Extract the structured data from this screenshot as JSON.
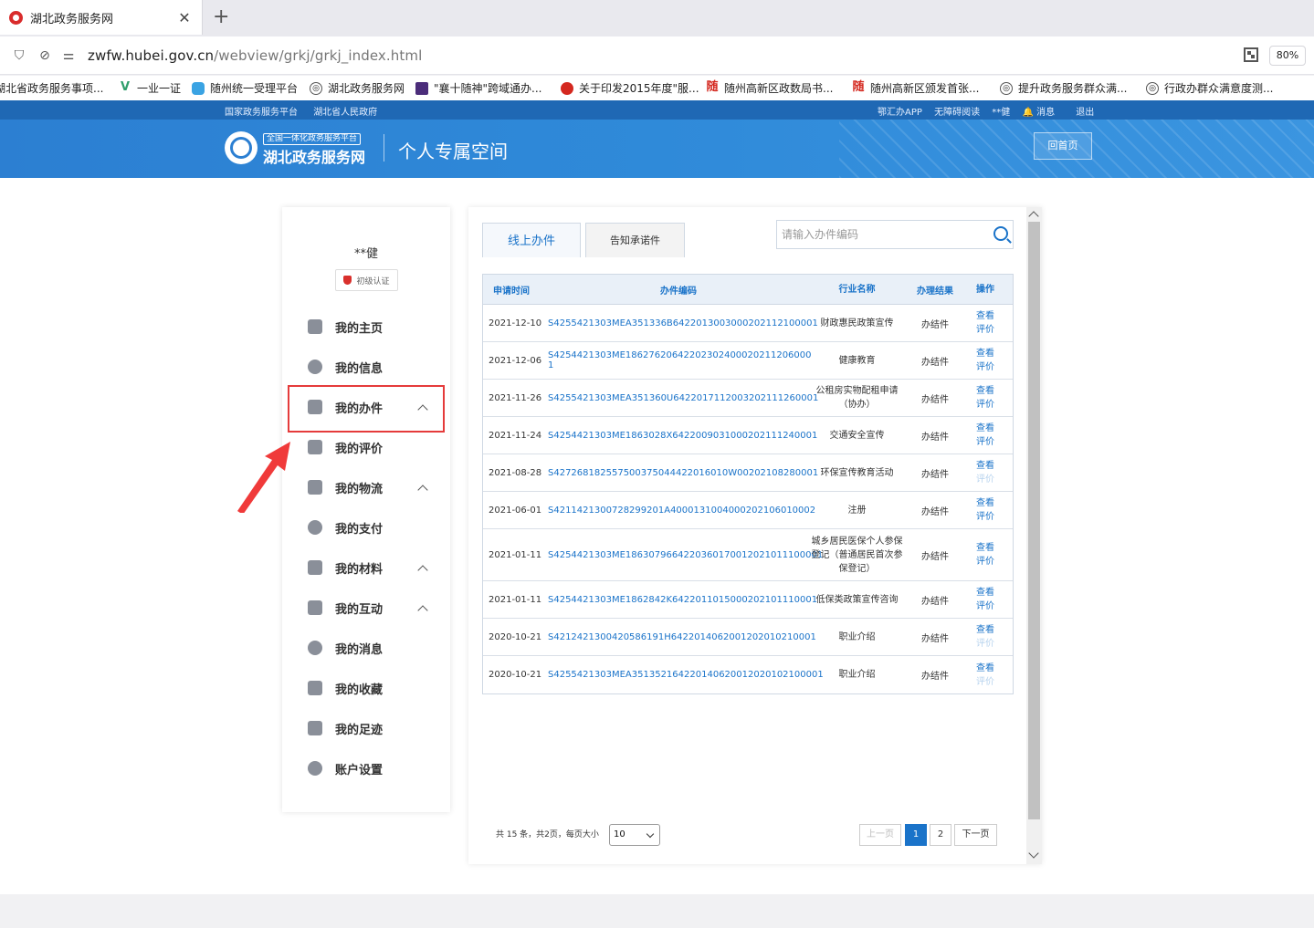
{
  "browser": {
    "tab_title": "湖北政务服务网",
    "url_host": "zwfw.hubei.gov.cn",
    "url_path": "/webview/grkj/grkj_index.html",
    "zoom": "80%",
    "bookmarks": [
      {
        "label": "湖北省政务服务事项...",
        "icon": "globe-icon"
      },
      {
        "label": "一业一证",
        "icon": "v-icon"
      },
      {
        "label": "随州统一受理平台",
        "icon": "cloud-icon"
      },
      {
        "label": "湖北政务服务网",
        "icon": "globe-icon"
      },
      {
        "label": "\"襄十随神\"跨域通办...",
        "icon": "inspur-icon"
      },
      {
        "label": "关于印发2015年度\"服...",
        "icon": "gov-emblem-icon"
      },
      {
        "label": "随州高新区政数局书...",
        "icon": "sui-icon"
      },
      {
        "label": "随州高新区颁发首张...",
        "icon": "sui-icon"
      },
      {
        "label": "提升政务服务群众满...",
        "icon": "globe-icon"
      },
      {
        "label": "行政办群众满意度测...",
        "icon": "globe-icon"
      }
    ]
  },
  "site": {
    "top_links_left": [
      "国家政务服务平台",
      "湖北省人民政府"
    ],
    "top_links_right": [
      "鄂汇办APP",
      "无障碍阅读",
      "**健",
      "消息",
      "退出"
    ],
    "logo_small": "全国一体化政务服务平台",
    "logo_big": "湖北政务服务网",
    "title": "个人专属空间",
    "home_button": "回首页"
  },
  "sidebar": {
    "username": "**健",
    "cert": "初级认证",
    "items": [
      {
        "label": "我的主页",
        "icon": "home-icon",
        "caret": false
      },
      {
        "label": "我的信息",
        "icon": "message-icon",
        "caret": false
      },
      {
        "label": "我的办件",
        "icon": "edit-icon",
        "caret": true
      },
      {
        "label": "我的评价",
        "icon": "document-icon",
        "caret": false
      },
      {
        "label": "我的物流",
        "icon": "box-icon",
        "caret": true
      },
      {
        "label": "我的支付",
        "icon": "yuan-icon",
        "caret": false
      },
      {
        "label": "我的材料",
        "icon": "book-icon",
        "caret": true
      },
      {
        "label": "我的互动",
        "icon": "chat-icon",
        "caret": true
      },
      {
        "label": "我的消息",
        "icon": "bell-icon",
        "caret": false
      },
      {
        "label": "我的收藏",
        "icon": "star-icon",
        "caret": false
      },
      {
        "label": "我的足迹",
        "icon": "footprint-icon",
        "caret": false
      },
      {
        "label": "账户设置",
        "icon": "gear-icon",
        "caret": false
      }
    ]
  },
  "main": {
    "tabs": [
      "线上办件",
      "告知承诺件"
    ],
    "search_placeholder": "请输入办件编码",
    "headers": [
      "申请时间",
      "办件编码",
      "行业名称",
      "办理结果",
      "操作"
    ],
    "rows": [
      {
        "date": "2021-12-10",
        "code": "S4255421303MEA351336B6422013003000202112100001",
        "industry": "财政惠民政策宣传",
        "result": "办结件",
        "view": "查看",
        "rate": "评价",
        "rate_dim": false
      },
      {
        "date": "2021-12-06",
        "code": "S4254421303ME18627620642202302400020211206000​1",
        "industry": "健康教育",
        "result": "办结件",
        "view": "查看",
        "rate": "评价",
        "rate_dim": false
      },
      {
        "date": "2021-11-26",
        "code": "S4255421303MEA351360U6422017112003202111260001",
        "industry": "公租房实物配租申请（协办）",
        "result": "办结件",
        "view": "查看",
        "rate": "评价",
        "rate_dim": false
      },
      {
        "date": "2021-11-24",
        "code": "S4254421303ME1863028X6422009031000202111240001",
        "industry": "交通安全宣传",
        "result": "办结件",
        "view": "查看",
        "rate": "评价",
        "rate_dim": false
      },
      {
        "date": "2021-08-28",
        "code": "S427268182557500375044422016010W00202108280001",
        "industry": "环保宣传教育活动",
        "result": "办结件",
        "view": "查看",
        "rate": "评价",
        "rate_dim": true
      },
      {
        "date": "2021-06-01",
        "code": "S4211421300728299201A4000131004000202106010002",
        "industry": "注册",
        "result": "办结件",
        "view": "查看",
        "rate": "评价",
        "rate_dim": false
      },
      {
        "date": "2021-01-11",
        "code": "S4254421303ME1863079664220360170012021011100001",
        "industry": "城乡居民医保个人参保登记（普通居民首次参保登记）",
        "result": "办结件",
        "view": "查看",
        "rate": "评价",
        "rate_dim": false
      },
      {
        "date": "2021-01-11",
        "code": "S4254421303ME1862842K6422011015000202101110001",
        "industry": "低保类政策宣传咨询",
        "result": "办结件",
        "view": "查看",
        "rate": "评价",
        "rate_dim": false
      },
      {
        "date": "2020-10-21",
        "code": "S4212421300420586191H6422014062001202010210001",
        "industry": "职业介绍",
        "result": "办结件",
        "view": "查看",
        "rate": "评价",
        "rate_dim": true
      },
      {
        "date": "2020-10-21",
        "code": "S4255421303MEA351352164220140620012020102100001",
        "industry": "职业介绍",
        "result": "办结件",
        "view": "查看",
        "rate": "评价",
        "rate_dim": true
      }
    ],
    "pager": {
      "info": "共 15 条，共2页，每页大小",
      "page_size": "10",
      "prev": "上一页",
      "pages": [
        "1",
        "2"
      ],
      "next": "下一页"
    }
  },
  "colors": {
    "accent": "#1a73c9",
    "header_blue": "#2c7fd2",
    "highlight_red": "#e53b3b"
  }
}
